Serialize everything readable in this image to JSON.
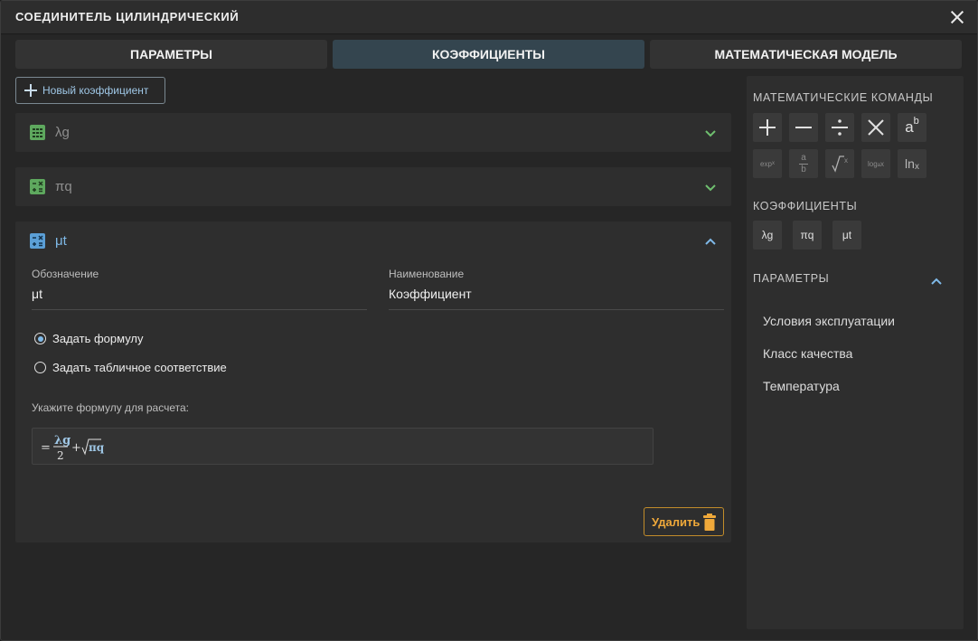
{
  "window": {
    "title": "СОЕДИНИТЕЛЬ ЦИЛИНДРИЧЕСКИЙ",
    "close_icon": "close-icon"
  },
  "tabs": [
    {
      "label": "ПАРАМЕТРЫ",
      "active": false
    },
    {
      "label": "КОЭФФИЦИЕНТЫ",
      "active": true
    },
    {
      "label": "МАТЕМАТИЧЕСКАЯ МОДЕЛЬ",
      "active": false
    }
  ],
  "toolbar": {
    "add_label": "Новый коэффициент"
  },
  "coefficients": [
    {
      "name": "λg",
      "icon": "table-icon",
      "expanded": false
    },
    {
      "name": "πq",
      "icon": "calculator-icon",
      "expanded": false
    },
    {
      "name": "μt",
      "icon": "calculator-icon",
      "expanded": true
    }
  ],
  "editor": {
    "designation_label": "Обозначение",
    "designation_value": "μt",
    "name_label": "Наименование",
    "name_value": "Коэффициент",
    "radio_formula": "Задать формулу",
    "radio_table": "Задать табличное соответствие",
    "selected_mode": "formula",
    "formula_hint": "Укажите формулу для расчета:",
    "formula": {
      "eq": "=",
      "numerator": "λg",
      "denominator": "2",
      "plus": "+",
      "radicand": "πq"
    },
    "delete_label": "Удалить"
  },
  "sidebar": {
    "math_title": "МАТЕМАТИЧЕСКИЕ КОМАНДЫ",
    "math_commands": [
      {
        "icon": "plus-icon"
      },
      {
        "icon": "minus-icon"
      },
      {
        "icon": "divide-icon"
      },
      {
        "icon": "multiply-icon"
      },
      {
        "label_base": "a",
        "label_sup": "b"
      },
      {
        "label": "exp",
        "label_sub": "x"
      },
      {
        "frac_top": "a",
        "frac_bottom": "b"
      },
      {
        "icon": "sqrt-icon",
        "label": "x"
      },
      {
        "label": "log",
        "label_sub": "a",
        "label_tail": "x"
      },
      {
        "label": "ln",
        "label_sub": "x"
      }
    ],
    "coef_title": "КОЭФФИЦИЕНТЫ",
    "coef_buttons": [
      "λg",
      "πq",
      "μt"
    ],
    "params_title": "ПАРАМЕТРЫ",
    "params": [
      "Условия эксплуатации",
      "Класс качества",
      "Температура"
    ]
  },
  "colors": {
    "accent": "#7fb9e8",
    "active_tab": "#34454f",
    "delete": "#f0a93a",
    "icon_green": "#5ea85e"
  }
}
